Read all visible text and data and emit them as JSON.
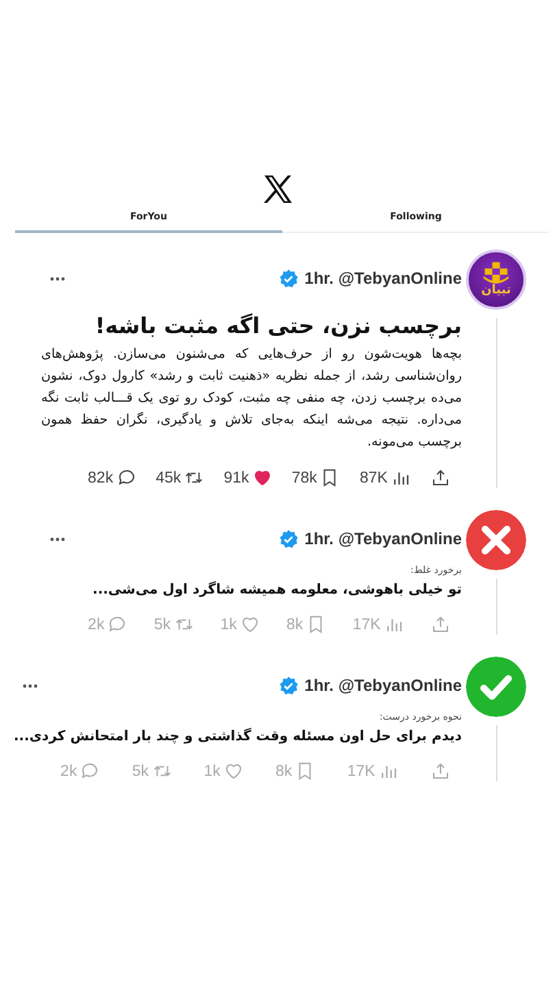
{
  "header": {
    "tabs": [
      {
        "label": "Following",
        "selected": false
      },
      {
        "label": "ForYou",
        "selected": true
      }
    ]
  },
  "posts": [
    {
      "avatar": {
        "kind": "logo",
        "label": "تبیان"
      },
      "handle": "1hr. @TebyanOnline",
      "verified": true,
      "title": "برچسب نزن، حتی اگه مثبت باشه!",
      "body": "بچه‌ها هویت‌شون رو از حرف‌هایی که می‌شنون می‌سازن. پژوهش‌های روان‌شناسی رشد، از جمله نظریه «ذهنیت ثابت و رشد» کارول دوک، نشون می‌ده برچسب زدن، چه منفی چه مثبت، کودک رو توی یک قـــالب ثابت نگه می‌داره. نتیجه می‌شه اینکه به‌جای تلاش و یادگیری، نگران حفظ همون برچسب می‌مونه.",
      "muted": false,
      "actions": [
        {
          "kind": "share"
        },
        {
          "kind": "views",
          "count": "87K"
        },
        {
          "kind": "bookmark",
          "count": "78k"
        },
        {
          "kind": "like",
          "count": "91k",
          "liked": true
        },
        {
          "kind": "repost",
          "count": "45k"
        },
        {
          "kind": "reply",
          "count": "82k"
        }
      ]
    },
    {
      "avatar": {
        "kind": "wrong"
      },
      "handle": "1hr. @TebyanOnline",
      "verified": true,
      "label": "برخورد غلط:",
      "text": "تو خیلی باهوشی، معلومه همیشه شاگرد اول می‌شی...",
      "muted": true,
      "actions": [
        {
          "kind": "share"
        },
        {
          "kind": "views",
          "count": "17K"
        },
        {
          "kind": "bookmark",
          "count": "8k"
        },
        {
          "kind": "like",
          "count": "1k",
          "liked": false
        },
        {
          "kind": "repost",
          "count": "5k"
        },
        {
          "kind": "reply",
          "count": "2k"
        }
      ]
    },
    {
      "avatar": {
        "kind": "right"
      },
      "handle": "1hr. @TebyanOnline",
      "verified": true,
      "label": "نحوه برخورد درست:",
      "text": "دیدم برای حل اون مسئله وقت گذاشتی و چند بار امتحانش کردی...",
      "muted": true,
      "actions": [
        {
          "kind": "share"
        },
        {
          "kind": "views",
          "count": "17K"
        },
        {
          "kind": "bookmark",
          "count": "8k"
        },
        {
          "kind": "like",
          "count": "1k",
          "liked": false
        },
        {
          "kind": "repost",
          "count": "5k"
        },
        {
          "kind": "reply",
          "count": "2k"
        }
      ]
    }
  ]
}
